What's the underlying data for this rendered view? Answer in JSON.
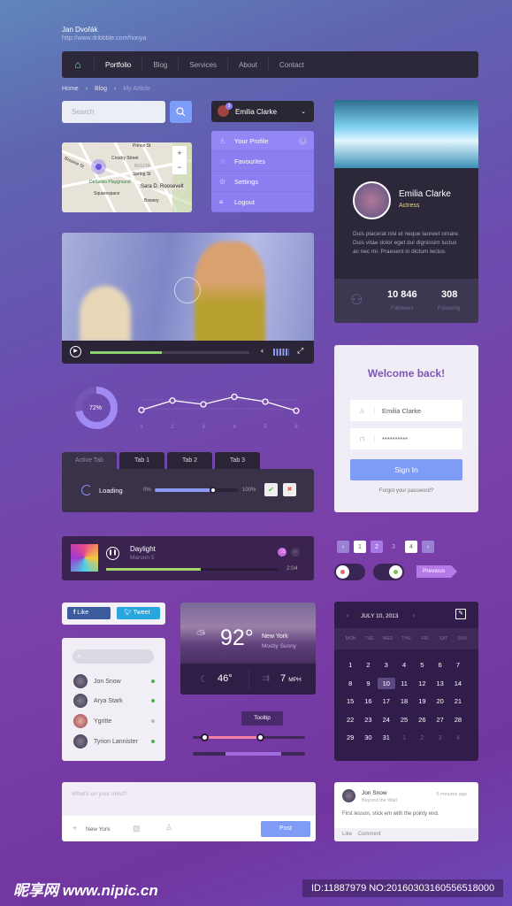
{
  "author": {
    "name": "Jan Dvořák",
    "url": "http://www.dribbble.com/honya"
  },
  "nav": {
    "items": [
      "Portfolio",
      "Blog",
      "Services",
      "About",
      "Contact"
    ],
    "active": "Portfolio"
  },
  "breadcrumb": [
    "Home",
    "Blog",
    "My Article"
  ],
  "search": {
    "placeholder": "Search"
  },
  "user": {
    "name": "Emilia Clarke",
    "badge": "3"
  },
  "menu": {
    "items": [
      {
        "label": "Your Profile",
        "icon": "user-icon",
        "badge": "3"
      },
      {
        "label": "Favourites",
        "icon": "star-icon"
      },
      {
        "label": "Settings",
        "icon": "wrench-icon"
      },
      {
        "label": "Logout",
        "icon": "lock-icon"
      }
    ]
  },
  "map": {
    "labels": [
      "Prince St",
      "Crosby Street",
      "NOLITA",
      "Spring St",
      "DeSalvio Playground",
      "Sara D. Roosevelt",
      "Squarespace",
      "Bowery",
      "Broome St"
    ],
    "zoom_in": "+",
    "zoom_out": "−"
  },
  "profile": {
    "name": "Emilia Clarke",
    "role": "Actress",
    "bio": "Duis placerat nisi et neque laoreet ornare. Duis vitae dolor eget dui dignissim luctus ac nec mi. Praesent in dictum lectus.",
    "followers": "10 846",
    "followers_label": "Followers",
    "following": "308",
    "following_label": "Following"
  },
  "video": {
    "progress": 0.45,
    "volume": 0.8
  },
  "donut": {
    "value": 72,
    "label": "72%"
  },
  "chart_data": {
    "type": "line",
    "categories": [
      "1",
      "2",
      "3",
      "4",
      "5",
      "6"
    ],
    "values": [
      2,
      4.5,
      3.5,
      5.5,
      4.2,
      1.8
    ],
    "ylim": [
      0,
      7
    ]
  },
  "tabs": [
    "Active Tab",
    "Tab 1",
    "Tab 2",
    "Tab 3"
  ],
  "panel": {
    "loading": "Loading",
    "min": "0%",
    "max": "100%",
    "slider": 0.7,
    "ok": "✔",
    "cancel": "✖"
  },
  "login": {
    "title": "Welcome back!",
    "username": "Emilia Clarke",
    "password": "**********",
    "submit": "Sign In",
    "forgot": "Forgot your password?"
  },
  "player": {
    "title": "Daylight",
    "artist": "Maroon 5",
    "time": "2:04",
    "progress": 0.55
  },
  "pagination": {
    "pages": [
      "1",
      "2",
      "3",
      "4"
    ],
    "active": "2"
  },
  "toggles": {
    "off_color": "#e46a6a",
    "on_color": "#7ec44a"
  },
  "previous": "Previous",
  "social": {
    "like": "Like",
    "tweet": "Tweet"
  },
  "contacts": [
    {
      "name": "Jon Snow",
      "online": true
    },
    {
      "name": "Arya Stark",
      "online": true
    },
    {
      "name": "Ygritte",
      "online": false
    },
    {
      "name": "Tyrion Lannister",
      "online": true
    }
  ],
  "weather": {
    "temp": "92°",
    "city": "New York",
    "condition": "Mostly Sunny",
    "night": "46°",
    "wind": "7",
    "wind_unit": "MPH"
  },
  "tooltip": "Tooltip",
  "range": {
    "low": 0.1,
    "high": 0.6
  },
  "calendar": {
    "title": "JULY 10, 2013",
    "days": [
      "MON",
      "TUE",
      "WED",
      "THU",
      "FRI",
      "SAT",
      "SUN"
    ],
    "dates": [
      "1",
      "2",
      "3",
      "4",
      "5",
      "6",
      "7",
      "8",
      "9",
      "10",
      "11",
      "12",
      "13",
      "14",
      "15",
      "16",
      "17",
      "18",
      "19",
      "20",
      "21",
      "22",
      "23",
      "24",
      "25",
      "26",
      "27",
      "28",
      "29",
      "30",
      "31",
      "1",
      "2",
      "3",
      "4"
    ],
    "selected": "10"
  },
  "compose": {
    "placeholder": "What's on your mind?",
    "location": "New York",
    "post": "Post"
  },
  "comment": {
    "name": "Jon Snow",
    "subtitle": "Beyond the Wall",
    "time": "5 minutes ago",
    "text": "First lesson, stick em with the pointy end.",
    "like": "Like",
    "comment": "Comment"
  },
  "watermark": {
    "site": "昵享网 www.nipic.cn",
    "id": "ID:11887979 NO:20160303160556518000"
  }
}
